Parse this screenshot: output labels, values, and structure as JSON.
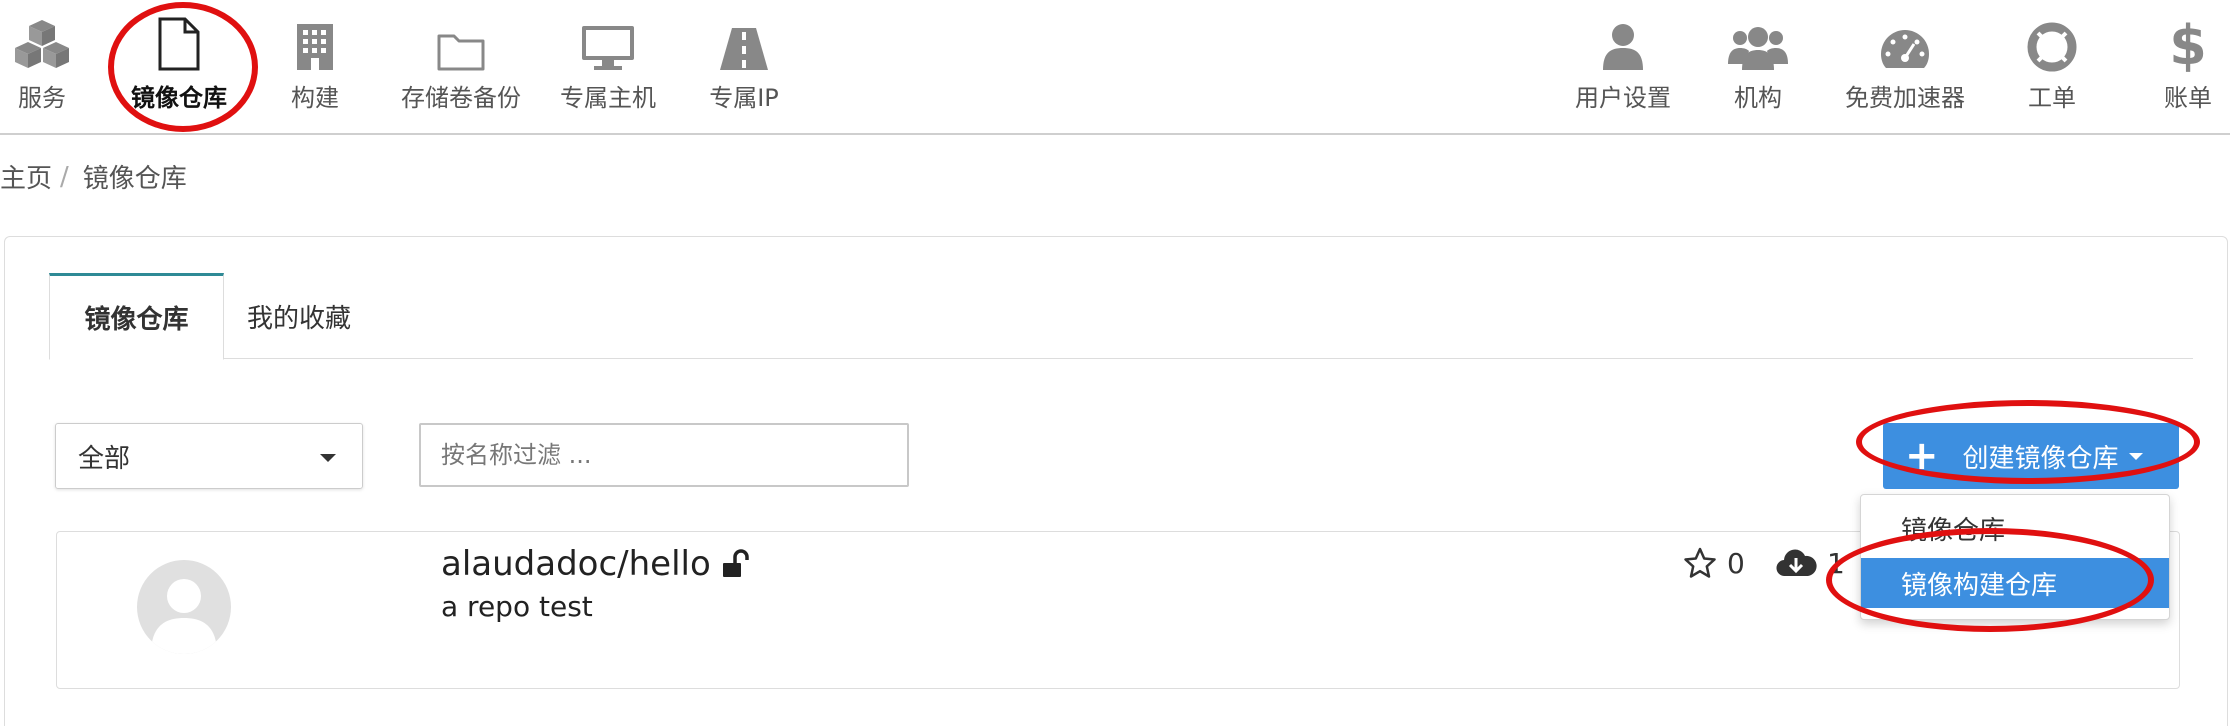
{
  "nav": {
    "left_items": [
      {
        "label": "服务",
        "icon": "cubes-icon"
      },
      {
        "label": "镜像仓库",
        "icon": "file-icon"
      },
      {
        "label": "构建",
        "icon": "building-icon"
      },
      {
        "label": "存储卷备份",
        "icon": "folder-icon"
      },
      {
        "label": "专属主机",
        "icon": "monitor-icon"
      },
      {
        "label": "专属IP",
        "icon": "road-icon"
      }
    ],
    "right_items": [
      {
        "label": "用户设置",
        "icon": "user-icon"
      },
      {
        "label": "机构",
        "icon": "users-icon"
      },
      {
        "label": "免费加速器",
        "icon": "dashboard-icon"
      },
      {
        "label": "工单",
        "icon": "lifebuoy-icon"
      },
      {
        "label": "账单",
        "icon": "dollar-icon"
      }
    ],
    "active_label": "镜像仓库"
  },
  "breadcrumb": {
    "home": "主页",
    "separator": "/",
    "current": "镜像仓库"
  },
  "tabs": {
    "repos": "镜像仓库",
    "favorites": "我的收藏"
  },
  "filter": {
    "selected": "全部",
    "placeholder": "按名称过滤 ..."
  },
  "create_button": {
    "label": "创建镜像仓库"
  },
  "dropdown": {
    "items": [
      "镜像仓库",
      "镜像构建仓库"
    ]
  },
  "repo": {
    "name": "alaudadoc/hello",
    "description": "a repo test",
    "stars": "0",
    "pulls": "1"
  },
  "colors": {
    "accent": "#3d8fe0",
    "annotation": "#e01010",
    "tab_top": "#2f8a96"
  }
}
